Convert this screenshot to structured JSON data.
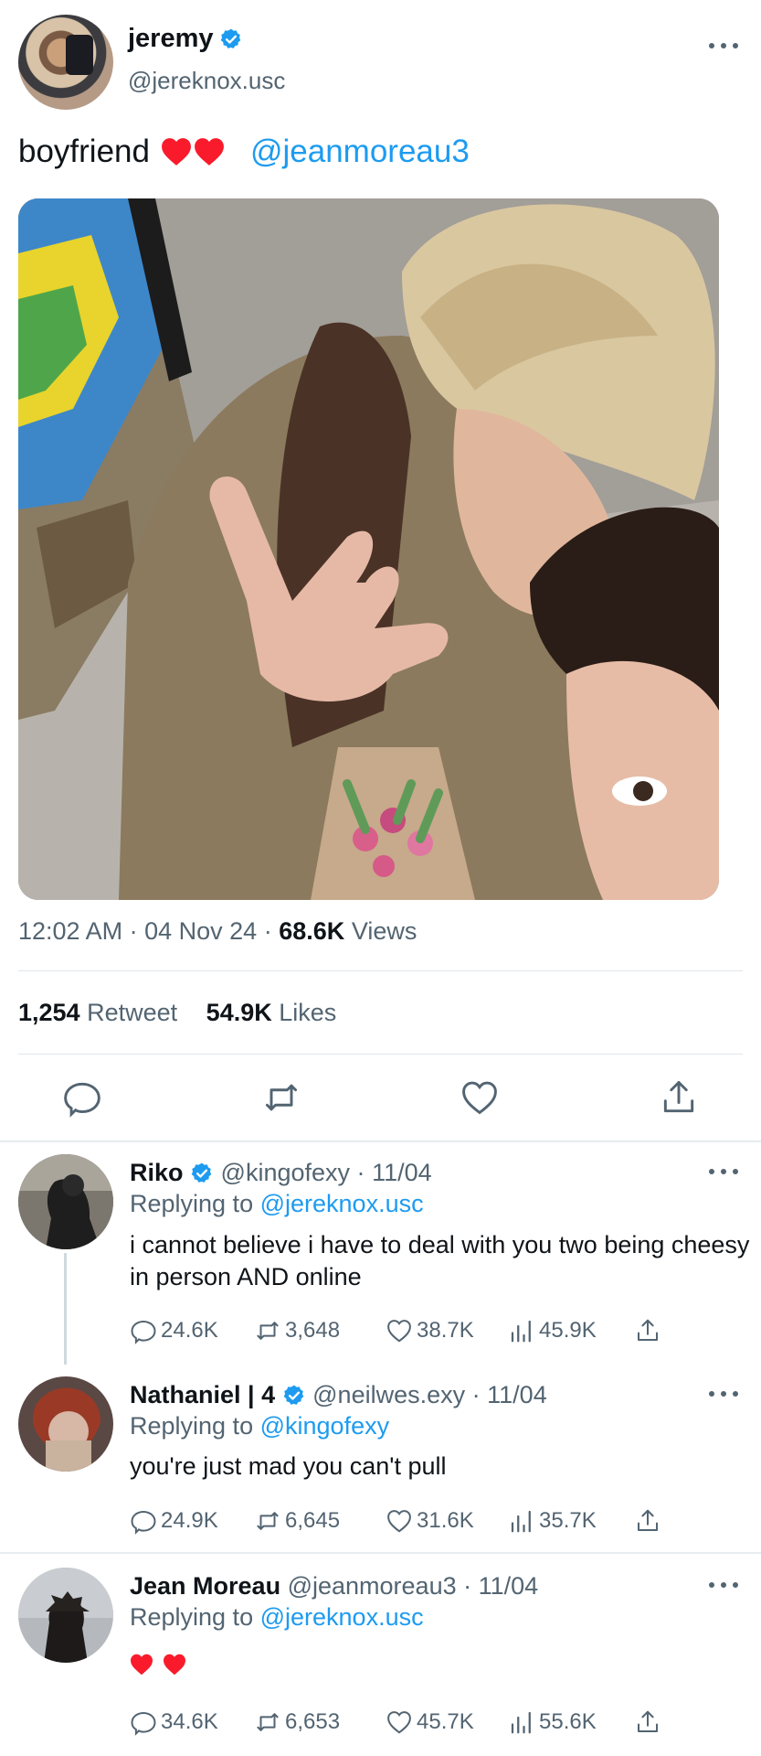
{
  "tweet": {
    "author": {
      "name": "jeremy",
      "handle": "@jereknox.usc",
      "verified": true
    },
    "text": "boyfriend",
    "mention": "@jeanmoreau3",
    "emoji": [
      "heart",
      "heart"
    ],
    "time": "12:02 AM",
    "date": "04 Nov 24",
    "sep": "·",
    "views_count": "68.6K",
    "views_label": "Views",
    "retweets_count": "1,254",
    "retweets_label": "Retweet",
    "likes_count": "54.9K",
    "likes_label": "Likes"
  },
  "icons": {
    "reply": "reply-icon",
    "retweet": "retweet-icon",
    "like": "heart-outline-icon",
    "share": "share-icon",
    "views": "bar-chart-icon",
    "more": "more-icon",
    "verified": "verified-badge-icon"
  },
  "colors": {
    "accent": "#1d9bf0",
    "text": "#0f1419",
    "muted": "#536471",
    "heart": "#f91b2b"
  },
  "replies": [
    {
      "name": "Riko",
      "verified": true,
      "handle": "@kingofexy",
      "date": "11/04",
      "replying_label": "Replying to",
      "replying_to": "@jereknox.usc",
      "text": "i cannot believe i have to deal with you two being cheesy in person AND online",
      "stats": {
        "replies": "24.6K",
        "retweets": "3,648",
        "likes": "38.7K",
        "views": "45.9K"
      }
    },
    {
      "name": "Nathaniel | 4",
      "verified": true,
      "handle": "@neilwes.exy",
      "date": "11/04",
      "replying_label": "Replying to",
      "replying_to": "@kingofexy",
      "text": "you're just mad you can't pull",
      "stats": {
        "replies": "24.9K",
        "retweets": "6,645",
        "likes": "31.6K",
        "views": "35.7K"
      }
    },
    {
      "name": "Jean Moreau",
      "verified": false,
      "handle": "@jeanmoreau3",
      "date": "11/04",
      "replying_label": "Replying to",
      "replying_to": "@jereknox.usc",
      "text": "",
      "emoji": [
        "heart",
        "heart"
      ],
      "stats": {
        "replies": "34.6K",
        "retweets": "6,653",
        "likes": "45.7K",
        "views": "55.6K"
      }
    }
  ]
}
